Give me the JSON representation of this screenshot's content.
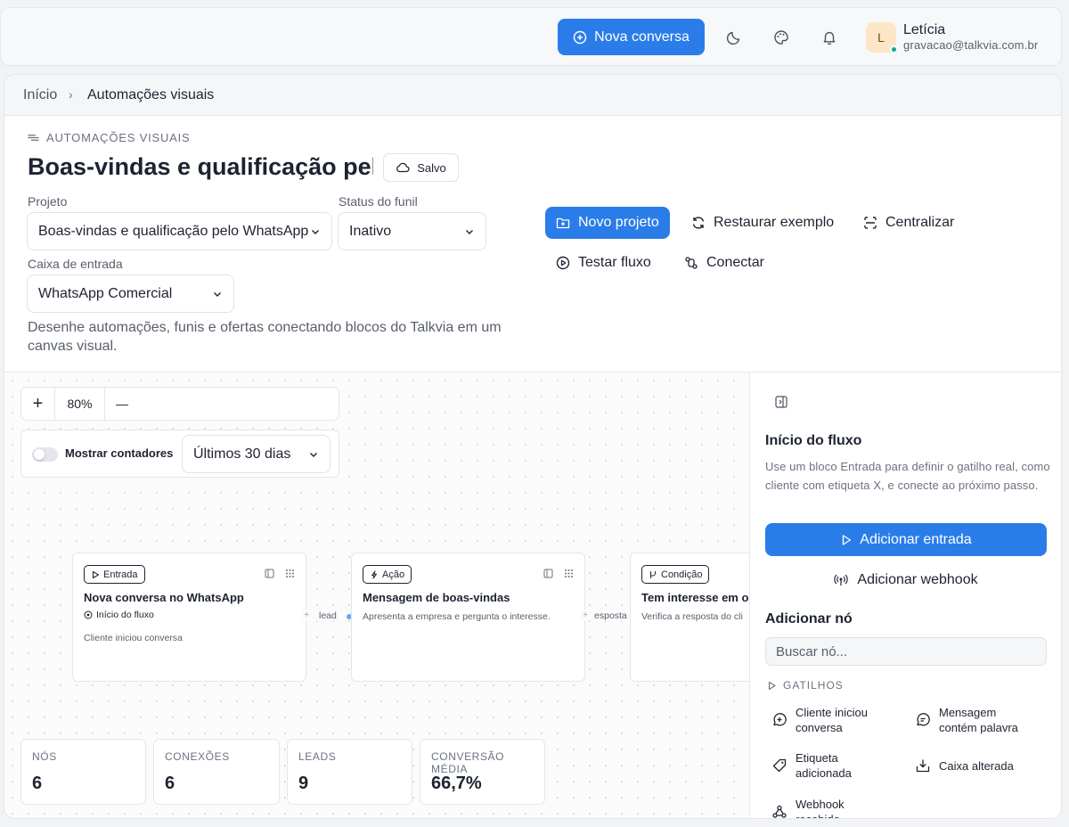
{
  "header": {
    "new_conversation": "Nova conversa",
    "user_initial": "L",
    "user_name": "Letícia",
    "user_email": "gravacao@talkvia.com.br"
  },
  "breadcrumb": {
    "home": "Início",
    "separator": "›",
    "current": "Automações visuais"
  },
  "page": {
    "section_label": "AUTOMAÇÕES VISUAIS",
    "title": "Boas-vindas e qualificação pelo WhatsApp",
    "saved_label": "Salvo",
    "description": "Desenhe automações, funis e ofertas conectando blocos do Talkvia em um canvas visual."
  },
  "form": {
    "project_label": "Projeto",
    "project_value": "Boas-vindas e qualificação pelo WhatsApp",
    "funnel_status_label": "Status do funil",
    "funnel_status_value": "Inativo",
    "inbox_label": "Caixa de entrada",
    "inbox_value": "WhatsApp Comercial"
  },
  "actions": {
    "new_project": "Novo projeto",
    "restore_example": "Restaurar exemplo",
    "center": "Centralizar",
    "test_flow": "Testar fluxo",
    "connect": "Conectar"
  },
  "canvas": {
    "zoom_in": "+",
    "zoom_level": "80%",
    "zoom_out": "—",
    "show_counters": "Mostrar contadores",
    "period": "Últimos 30 dias"
  },
  "nodes": [
    {
      "badge": "Entrada",
      "title": "Nova conversa no WhatsApp",
      "subtitle": "Início do fluxo",
      "description": "Cliente iniciou conversa"
    },
    {
      "badge": "Ação",
      "title": "Mensagem de boas-vindas",
      "description": "Apresenta a empresa e pergunta o interesse."
    },
    {
      "badge": "Condição",
      "title": "Tem interesse em or",
      "description": "Verifica a resposta do cli"
    }
  ],
  "edges": [
    {
      "label": "lead"
    },
    {
      "label": "esposta"
    }
  ],
  "stats": [
    {
      "label": "NÓS",
      "value": "6"
    },
    {
      "label": "CONEXÕES",
      "value": "6"
    },
    {
      "label": "LEADS",
      "value": "9"
    },
    {
      "label": "CONVERSÃO MÉDIA",
      "value": "66,7%"
    }
  ],
  "panel": {
    "title": "Início do fluxo",
    "description": "Use um bloco Entrada para definir o gatilho real, como cliente com etiqueta X, e conecte ao próximo passo.",
    "add_entry": "Adicionar entrada",
    "add_webhook": "Adicionar webhook",
    "add_node_title": "Adicionar nó",
    "search_placeholder": "Buscar nó...",
    "triggers_label": "GATILHOS",
    "triggers": [
      {
        "line1": "Cliente iniciou",
        "line2": "conversa"
      },
      {
        "line1": "Mensagem",
        "line2": "contém palavra"
      },
      {
        "line1": "Etiqueta",
        "line2": "adicionada"
      },
      {
        "line1": "Caixa alterada",
        "line2": ""
      },
      {
        "line1": "Webhook",
        "line2": "recebido"
      }
    ]
  },
  "colors": {
    "accent": "#2a7de9",
    "online": "#17a589",
    "avatar_bg": "#fde6c8"
  }
}
